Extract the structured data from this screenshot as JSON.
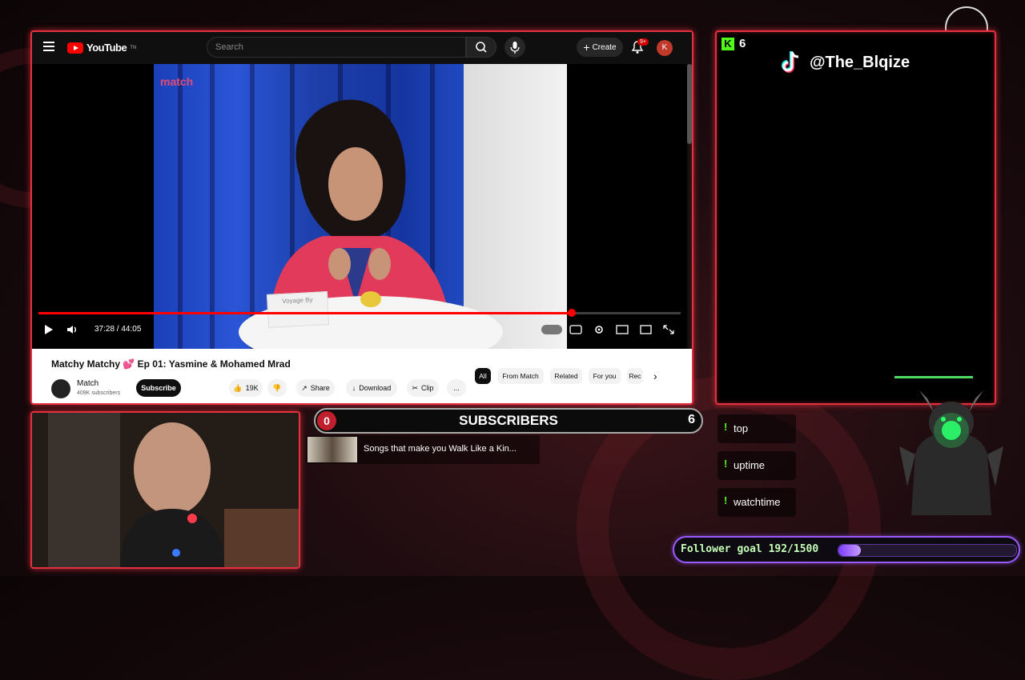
{
  "youtube": {
    "logo_text": "YouTube",
    "logo_sup": "TN",
    "search_placeholder": "Search",
    "create_label": "Create",
    "notif_badge": "9+",
    "avatar_letter": "K",
    "video_logo": "match",
    "time_display": "37:28 / 44:05",
    "progress_fraction": 0.83,
    "video_title": "Matchy Matchy 💕 Ep 01: Yasmine & Mohamed Mrad",
    "channel_name": "Match",
    "channel_subs": "409K subscribers",
    "subscribe_label": "Subscribe",
    "like_count": "19K",
    "share_label": "Share",
    "download_label": "Download",
    "clip_label": "Clip",
    "more_label": "...",
    "chips": [
      "All",
      "From Match",
      "Related",
      "For you",
      "Rec"
    ],
    "placecard": "Voyage By"
  },
  "tiktok": {
    "kick_count": "6",
    "handle": "@The_Blqize"
  },
  "subs_bar": {
    "left_value": "0",
    "title": "SUBSCRIBERS",
    "right_value": "6"
  },
  "song": {
    "title": "Songs that make you Walk Like a Kin..."
  },
  "commands": [
    "top",
    "uptime",
    "watchtime"
  ],
  "follower_goal": {
    "label": "Follower goal 192/1500",
    "current": 192,
    "target": 1500
  },
  "colors": {
    "frame_red": "#e5313f",
    "kick_green": "#53fc18",
    "goal_purple": "#9b59ff"
  }
}
